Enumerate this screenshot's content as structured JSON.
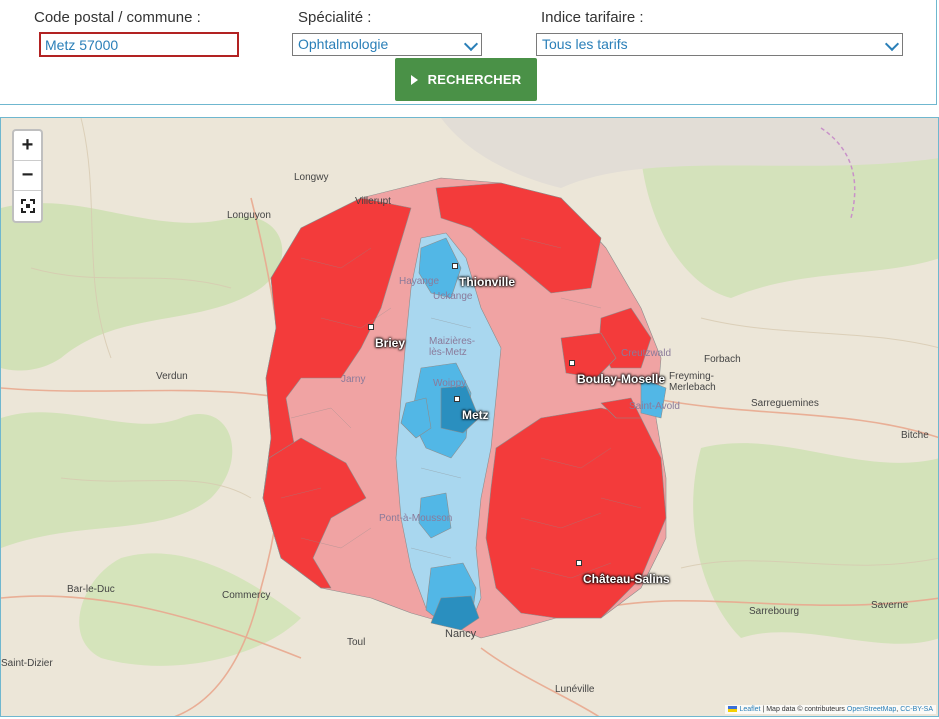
{
  "form": {
    "postal": {
      "label": "Code postal / commune :",
      "value": "Metz 57000"
    },
    "specialty": {
      "label": "Spécialité :",
      "value": "Ophtalmologie"
    },
    "tariff": {
      "label": "Indice tarifaire :",
      "value": "Tous les tarifs"
    },
    "search_label": "RECHERCHER"
  },
  "map": {
    "zoom_in": "+",
    "zoom_out": "−",
    "attribution": {
      "leaflet": "Leaflet",
      "text": " | Map data © contributeurs ",
      "osm": "OpenStreetMap",
      "sep": ", ",
      "license": "CC-BY-SA"
    },
    "places": [
      "Longwy",
      "Villerupt",
      "Longuyon",
      "Thionville",
      "Hayange",
      "Uckange",
      "Briey",
      "Maizières-lès-Metz",
      "Verdun",
      "Jarny",
      "Metz",
      "Woippy",
      "Boulay-Moselle",
      "Creutzwald",
      "Forbach",
      "Freyming-Merlebach",
      "Saint-Avold",
      "Sarreguemines",
      "Bitche",
      "Pont-à-Mousson",
      "Château-Salins",
      "Bar-le-Duc",
      "Commercy",
      "Toul",
      "Nancy",
      "Sarrebourg",
      "Saverne",
      "Saint-Dizier",
      "Lunéville"
    ]
  },
  "colors": {
    "brand_green": "#4a9147",
    "red_dark": "#f33b3b",
    "red_light": "#f0a3a3",
    "blue_light": "#a9d7ef",
    "blue_mid": "#52b7e6",
    "blue_dark": "#2a8fbf"
  }
}
